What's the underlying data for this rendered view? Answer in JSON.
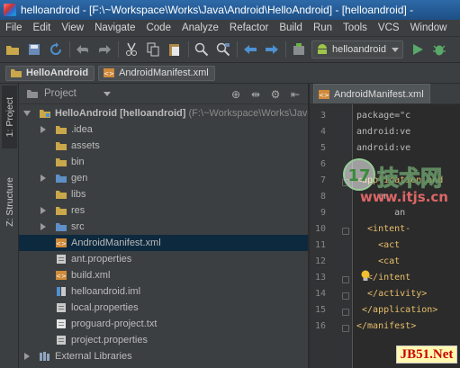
{
  "window": {
    "title": "helloandroid - [F:\\~Workspace\\Works\\Java\\Android\\HelloAndroid] - [helloandroid] -"
  },
  "menu": {
    "items": [
      "File",
      "Edit",
      "View",
      "Navigate",
      "Code",
      "Analyze",
      "Refactor",
      "Build",
      "Run",
      "Tools",
      "VCS",
      "Window"
    ]
  },
  "toolbar": {
    "run_config": "helloandroid"
  },
  "breadcrumb": {
    "items": [
      "HelloAndroid",
      "AndroidManifest.xml"
    ]
  },
  "tool_strip": {
    "project_tab": "1: Project",
    "structure_tab": "Z: Structure"
  },
  "project_panel": {
    "header": "Project",
    "root": {
      "name": "HelloAndroid",
      "module": "[helloandroid]",
      "path": "(F:\\~Workspace\\Works\\Java"
    },
    "items": [
      {
        "label": ".idea",
        "type": "folder",
        "expandable": true
      },
      {
        "label": "assets",
        "type": "folder",
        "expandable": false
      },
      {
        "label": "bin",
        "type": "folder",
        "expandable": false
      },
      {
        "label": "gen",
        "type": "folder-src",
        "expandable": true
      },
      {
        "label": "libs",
        "type": "folder",
        "expandable": false
      },
      {
        "label": "res",
        "type": "folder",
        "expandable": true
      },
      {
        "label": "src",
        "type": "folder-src",
        "expandable": true
      },
      {
        "label": "AndroidManifest.xml",
        "type": "xml",
        "expandable": false,
        "selected": true
      },
      {
        "label": "ant.properties",
        "type": "properties",
        "expandable": false
      },
      {
        "label": "build.xml",
        "type": "xml",
        "expandable": false
      },
      {
        "label": "helloandroid.iml",
        "type": "iml",
        "expandable": false
      },
      {
        "label": "local.properties",
        "type": "properties",
        "expandable": false
      },
      {
        "label": "proguard-project.txt",
        "type": "text",
        "expandable": false
      },
      {
        "label": "project.properties",
        "type": "properties",
        "expandable": false
      }
    ],
    "external": "External Libraries"
  },
  "editor": {
    "tab": "AndroidManifest.xml",
    "lines": [
      {
        "n": "3",
        "code": "package=\"c"
      },
      {
        "n": "4",
        "code": "android:ve"
      },
      {
        "n": "5",
        "code": "android:ve"
      },
      {
        "n": "6",
        "code": ""
      },
      {
        "n": "7",
        "code": "<application and"
      },
      {
        "n": "8",
        "code": "    an"
      },
      {
        "n": "9",
        "code": "       an"
      },
      {
        "n": "10",
        "code": "  <intent-"
      },
      {
        "n": "11",
        "code": "    <act"
      },
      {
        "n": "12",
        "code": "    <cat"
      },
      {
        "n": "13",
        "code": "  </intent"
      },
      {
        "n": "14",
        "code": "  </activity>"
      },
      {
        "n": "15",
        "code": " </application>"
      },
      {
        "n": "16",
        "code": "</manifest>"
      }
    ]
  },
  "watermark": {
    "cn": "技术网",
    "site": "www.itjs.cn",
    "badge": "JB51.Net"
  }
}
